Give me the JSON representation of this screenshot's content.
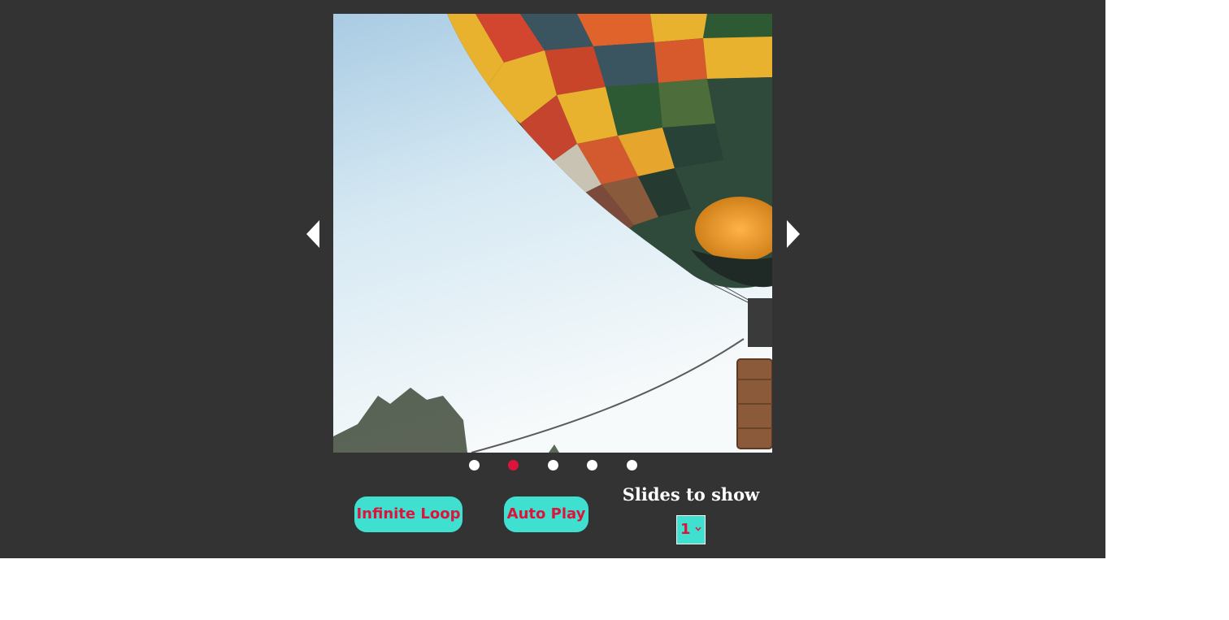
{
  "colors": {
    "page_background": "#ffffff",
    "stage_background": "#333333",
    "accent": "#40e0d0",
    "accent_text": "#dc143c",
    "dot_inactive": "#ffffff",
    "dot_active": "#dc143c",
    "arrow": "#ffffff"
  },
  "carousel": {
    "slide_image": "hot-air-balloon-photo",
    "prev_icon": "caret-left-icon",
    "next_icon": "caret-right-icon",
    "current_index": 1,
    "dots": [
      {
        "active": false
      },
      {
        "active": true
      },
      {
        "active": false
      },
      {
        "active": false
      },
      {
        "active": false
      }
    ]
  },
  "controls": {
    "infinite_loop_label": "Infinite Loop",
    "auto_play_label": "Auto Play",
    "slides_to_show_label": "Slides to show",
    "slides_to_show_value": "1",
    "select_icon": "chevron-down-icon"
  }
}
